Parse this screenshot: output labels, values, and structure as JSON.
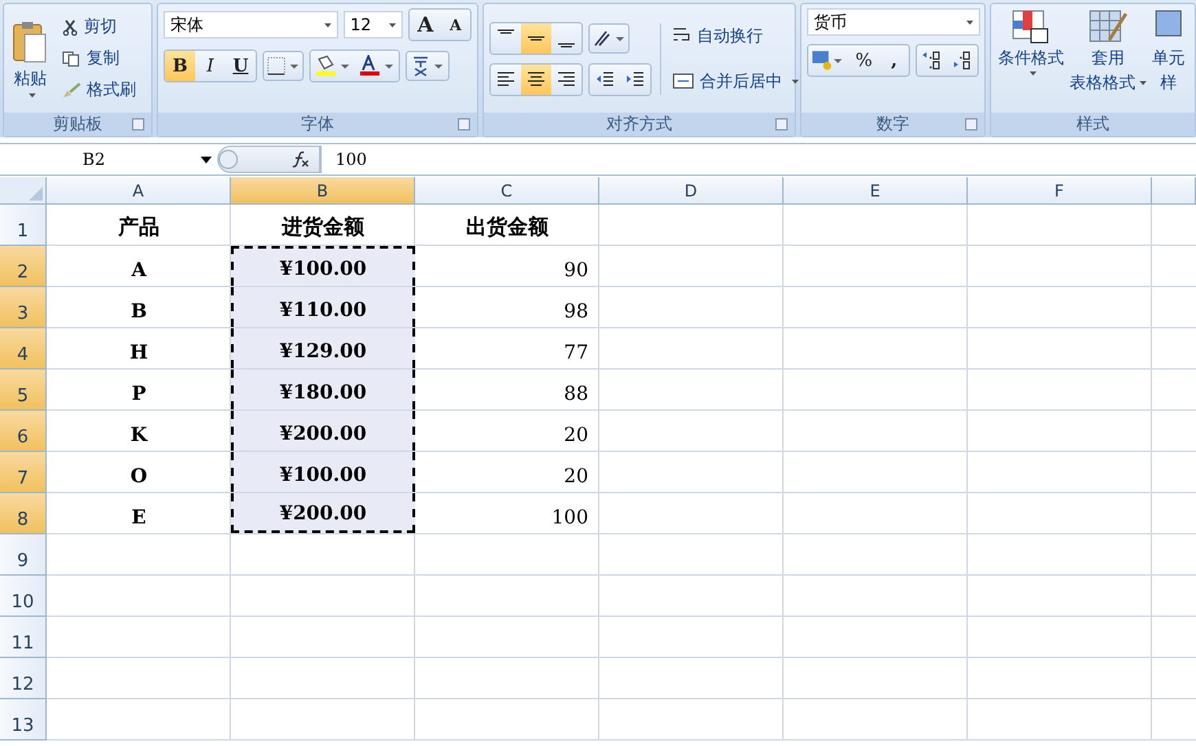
{
  "clipboard": {
    "paste": "粘贴",
    "cut": "剪切",
    "copy": "复制",
    "painter": "格式刷",
    "label": "剪贴板"
  },
  "font": {
    "name": "宋体",
    "size": "12",
    "grow": "A",
    "shrink": "A",
    "styles": [
      {
        "label": "B",
        "kind": "bold",
        "on": true
      },
      {
        "label": "I",
        "kind": "italic",
        "on": false
      },
      {
        "label": "U",
        "kind": "underline",
        "on": false
      }
    ],
    "label": "字体"
  },
  "alignment": {
    "vertical": [
      {
        "selected": false
      },
      {
        "selected": true
      },
      {
        "selected": false
      }
    ],
    "horizontal": [
      {
        "selected": false
      },
      {
        "selected": true
      },
      {
        "selected": false
      }
    ],
    "wrap": "自动换行",
    "merge": "合并后居中",
    "label": "对齐方式"
  },
  "number": {
    "format": "货币",
    "percent": "%",
    "comma": ",",
    "label": "数字"
  },
  "styles": {
    "conditional": "条件格式",
    "table_line_1": "套用",
    "table_line_2": "表格格式",
    "cell_line_1": "单元",
    "cell_line_2": "样",
    "label": "样式"
  },
  "formula_bar": {
    "name_box": "B2",
    "value": "100"
  },
  "sheet": {
    "columns": [
      {
        "label": "A",
        "selected": false
      },
      {
        "label": "B",
        "selected": true
      },
      {
        "label": "C",
        "selected": false
      },
      {
        "label": "D",
        "selected": false
      },
      {
        "label": "E",
        "selected": false
      },
      {
        "label": "F",
        "selected": false
      }
    ],
    "rows": [
      {
        "label": "1",
        "selected": false,
        "cells": [
          "产品",
          "进货金额",
          "出货金额"
        ]
      },
      {
        "label": "2",
        "selected": true,
        "cells": [
          "A",
          "¥100.00",
          "90"
        ]
      },
      {
        "label": "3",
        "selected": true,
        "cells": [
          "B",
          "¥110.00",
          "98"
        ]
      },
      {
        "label": "4",
        "selected": true,
        "cells": [
          "H",
          "¥129.00",
          "77"
        ]
      },
      {
        "label": "5",
        "selected": true,
        "cells": [
          "P",
          "¥180.00",
          "88"
        ]
      },
      {
        "label": "6",
        "selected": true,
        "cells": [
          "K",
          "¥200.00",
          "20"
        ]
      },
      {
        "label": "7",
        "selected": true,
        "cells": [
          "O",
          "¥100.00",
          "20"
        ]
      },
      {
        "label": "8",
        "selected": true,
        "cells": [
          "E",
          "¥200.00",
          "100"
        ]
      },
      {
        "label": "9",
        "selected": false,
        "cells": []
      },
      {
        "label": "10",
        "selected": false,
        "cells": []
      },
      {
        "label": "11",
        "selected": false,
        "cells": []
      },
      {
        "label": "12",
        "selected": false,
        "cells": []
      },
      {
        "label": "13",
        "selected": false,
        "cells": []
      }
    ]
  }
}
